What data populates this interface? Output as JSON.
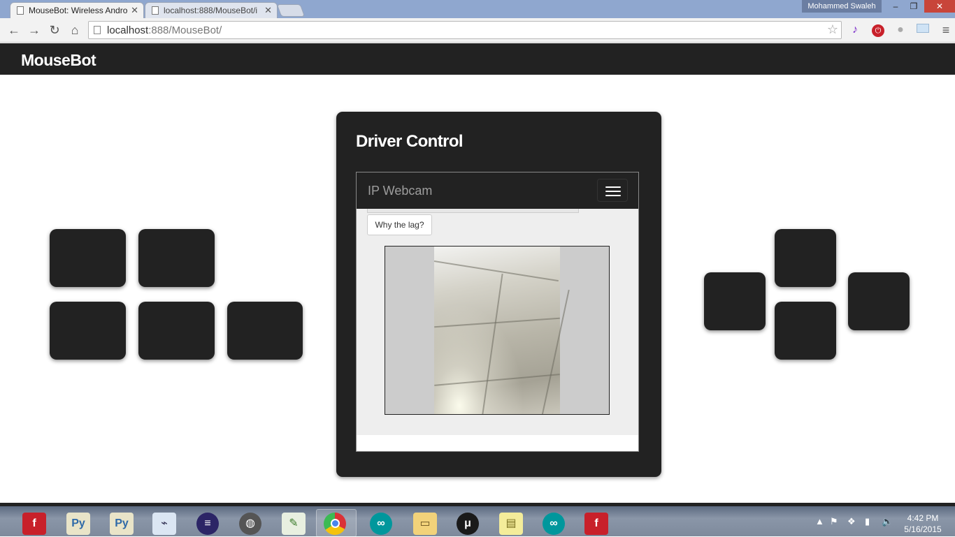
{
  "browser": {
    "tabs": [
      {
        "title": "MouseBot: Wireless Andro",
        "active": true
      },
      {
        "title": "localhost:888/MouseBot/i",
        "active": false
      }
    ],
    "user": "Mohammed Swaleh",
    "window_controls": {
      "minimize": "–",
      "restore": "❐",
      "close": "✕"
    },
    "url_host": "localhost",
    "url_rest": ":888/MouseBot/"
  },
  "app": {
    "brand": "MouseBot",
    "panel_title": "Driver Control",
    "webcam": {
      "brand": "IP Webcam",
      "lag_button": "Why the lag?"
    }
  },
  "taskbar": {
    "clock_time": "4:42 PM",
    "clock_date": "5/16/2015"
  },
  "colors": {
    "navbar": "#222222",
    "control_button": "#222222",
    "panel": "#222222"
  }
}
